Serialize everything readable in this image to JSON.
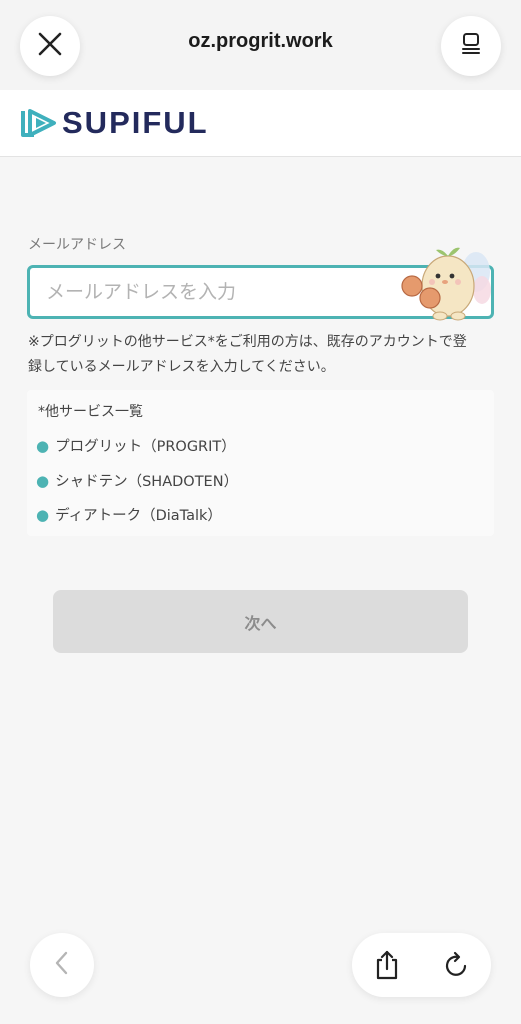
{
  "browser": {
    "url": "oz.progrit.work",
    "close_icon": "close-icon",
    "tabs_icon": "tabs-icon",
    "back_icon": "chevron-left-icon",
    "share_icon": "share-icon",
    "reload_icon": "reload-icon"
  },
  "header": {
    "logo_text": "SUPIFUL",
    "brand_color": "#232a5c",
    "accent_color": "#4db3b3"
  },
  "form": {
    "email_label": "メールアドレス",
    "email_placeholder": "メールアドレスを入力",
    "email_value": "",
    "note_line1": "※プログリットの他サービス*をご利用の方は、既存のアカウントで登",
    "note_line2": "録しているメールアドレスを入力してください。",
    "services_title": "*他サービス一覧",
    "services": [
      {
        "label": "プログリット（PROGRIT）"
      },
      {
        "label": "シャドテン（SHADOTEN）"
      },
      {
        "label": "ディアトーク（DiaTalk）"
      }
    ],
    "next_button": "次へ"
  }
}
